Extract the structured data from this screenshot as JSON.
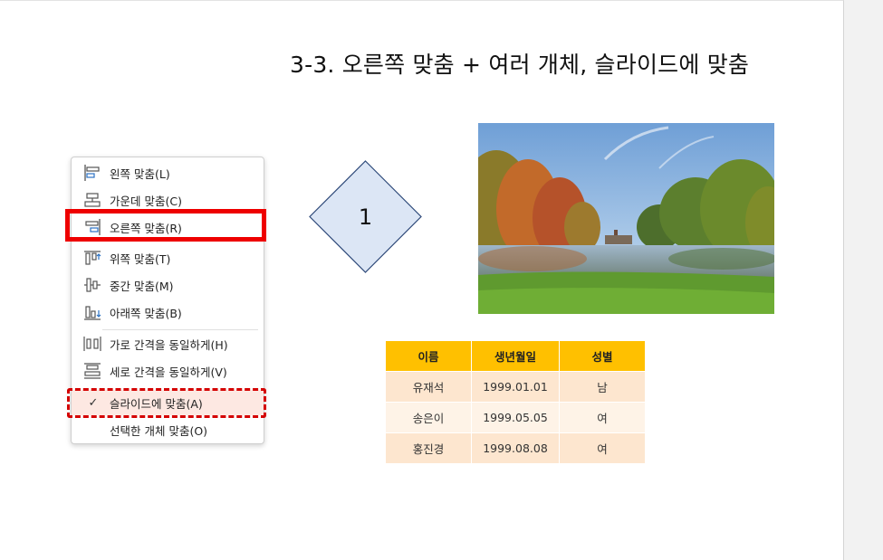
{
  "slide": {
    "title": "3-3. 오른쪽 맞춤 + 여러 개체, 슬라이드에 맞춤"
  },
  "menu": {
    "items": [
      {
        "label": "왼쪽 맞춤(L)",
        "icon": "align-left-icon"
      },
      {
        "label": "가운데 맞춤(C)",
        "icon": "align-center-icon"
      },
      {
        "label": "오른쪽 맞춤(R)",
        "icon": "align-right-icon"
      },
      {
        "label": "위쪽 맞춤(T)",
        "icon": "align-top-icon"
      },
      {
        "label": "중간 맞춤(M)",
        "icon": "align-middle-icon"
      },
      {
        "label": "아래쪽 맞춤(B)",
        "icon": "align-bottom-icon"
      },
      {
        "label": "가로 간격을 동일하게(H)",
        "icon": "distribute-horizontal-icon"
      },
      {
        "label": "세로 간격을 동일하게(V)",
        "icon": "distribute-vertical-icon"
      },
      {
        "label": "슬라이드에 맞춤(A)",
        "icon": "check-icon",
        "checked": true
      },
      {
        "label": "선택한 개체 맞춤(O)",
        "icon": ""
      }
    ]
  },
  "diamond": {
    "text": "1"
  },
  "table": {
    "headers": [
      "이름",
      "생년월일",
      "성별"
    ],
    "rows": [
      [
        "유재석",
        "1999.01.01",
        "남"
      ],
      [
        "송은이",
        "1999.05.05",
        "여"
      ],
      [
        "홍진경",
        "1999.08.08",
        "여"
      ]
    ]
  },
  "colors": {
    "highlight": "#ee0000",
    "header": "#ffc000",
    "diamond_fill": "#dce6f5",
    "diamond_stroke": "#2f4a7a",
    "icon_blue": "#2b72c4"
  }
}
